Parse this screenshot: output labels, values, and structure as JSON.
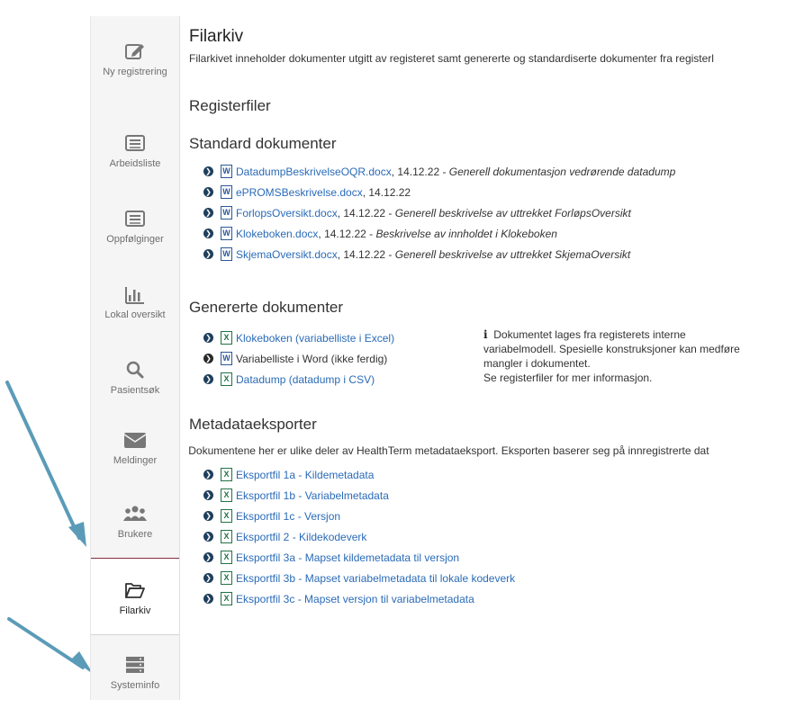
{
  "sidebar": {
    "items": [
      {
        "label": "Ny registrering",
        "icon": "edit-icon"
      },
      {
        "label": "Arbeidsliste",
        "icon": "list-icon"
      },
      {
        "label": "Oppfølginger",
        "icon": "list-icon"
      },
      {
        "label": "Lokal oversikt",
        "icon": "bar-chart-icon"
      },
      {
        "label": "Pasientsøk",
        "icon": "search-icon"
      },
      {
        "label": "Meldinger",
        "icon": "envelope-icon"
      },
      {
        "label": "Brukere",
        "icon": "users-icon"
      },
      {
        "label": "Filarkiv",
        "icon": "folder-open-icon",
        "active": true
      },
      {
        "label": "Systeminfo",
        "icon": "server-icon"
      }
    ]
  },
  "main": {
    "title": "Filarkiv",
    "description": "Filarkivet inneholder dokumenter utgitt av registeret samt genererte og standardiserte dokumenter fra registerl",
    "registerfiler_heading": "Registerfiler",
    "standard_heading": "Standard dokumenter",
    "standard_docs": [
      {
        "name": "DatadumpBeskrivelseOQR.docx",
        "meta": ", 14.12.22 -",
        "note": "Generell dokumentasjon vedrørende datadump"
      },
      {
        "name": "ePROMSBeskrivelse.docx",
        "meta": ", 14.12.22",
        "note": ""
      },
      {
        "name": "ForlopsOversikt.docx",
        "meta": ", 14.12.22 -",
        "note": "Generell beskrivelse av uttrekket ForløpsOversikt"
      },
      {
        "name": "Klokeboken.docx",
        "meta": ", 14.12.22 -",
        "note": "Beskrivelse av innholdet i Klokeboken"
      },
      {
        "name": "SkjemaOversikt.docx",
        "meta": ", 14.12.22 -",
        "note": "Generell beskrivelse av uttrekket SkjemaOversikt"
      }
    ],
    "genererte_heading": "Genererte dokumenter",
    "genererte_docs": [
      {
        "name": "Klokeboken (variabelliste i Excel)",
        "type": "xls",
        "link": true
      },
      {
        "name": "Variabelliste i Word (ikke ferdig)",
        "type": "doc",
        "link": false
      },
      {
        "name": "Datadump (datadump i CSV)",
        "type": "xls",
        "link": true
      }
    ],
    "genererte_info": [
      "Dokumentet lages fra registerets interne",
      "variabelmodell. Spesielle konstruksjoner kan medføre",
      "mangler i dokumentet.",
      "Se registerfiler for mer informasjon."
    ],
    "metadata_heading": "Metadataeksporter",
    "metadata_info": "Dokumentene her er ulike deler av HealthTerm metadataeksport. Eksporten baserer seg på innregistrerte dat",
    "metadata_docs": [
      "Eksportfil 1a - Kildemetadata",
      "Eksportfil 1b - Variabelmetadata",
      "Eksportfil 1c - Versjon",
      "Eksportfil 2 - Kildekodeverk",
      "Eksportfil 3a - Mapset kildemetadata til versjon",
      "Eksportfil 3b - Mapset variabelmetadata til lokale kodeverk",
      "Eksportfil 3c - Mapset versjon til variabelmetadata"
    ]
  },
  "colors": {
    "link": "#2a6bb8",
    "active_border": "#8b2b3a",
    "arrow": "#5b9bb8",
    "bullet": "#1f3f5d"
  }
}
